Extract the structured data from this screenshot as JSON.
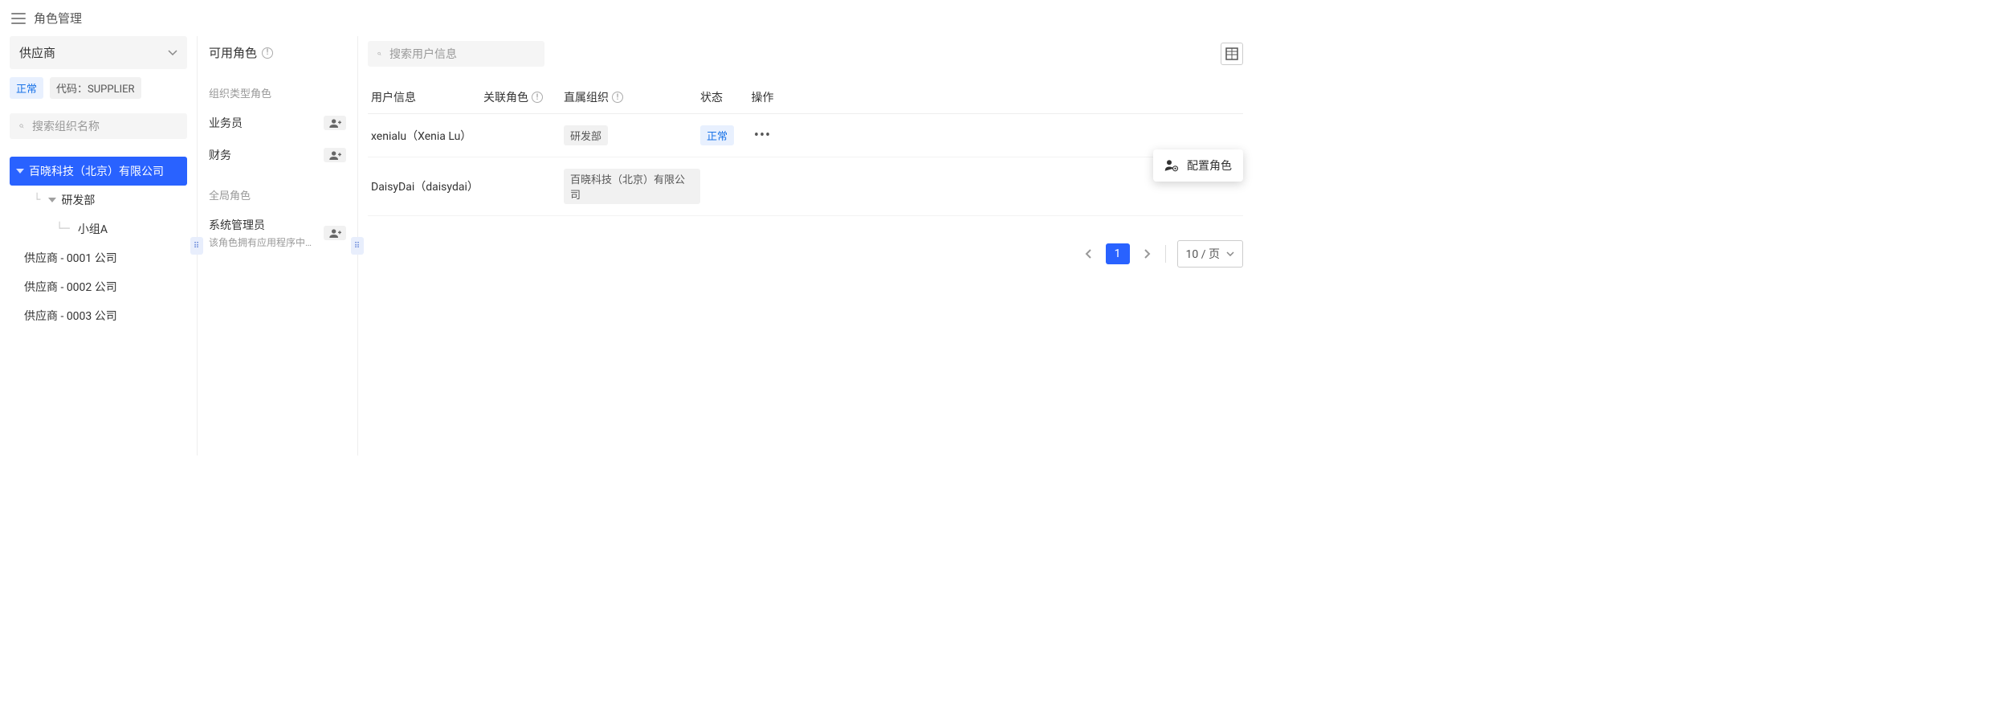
{
  "header": {
    "title": "角色管理"
  },
  "left": {
    "type_select": "供应商",
    "status_chip": "正常",
    "code_chip": "代码：SUPPLIER",
    "search_placeholder": "搜索组织名称",
    "tree": {
      "root": "百晓科技（北京）有限公司",
      "child1": "研发部",
      "grandchild1": "小组A",
      "sibling1": "供应商 - 0001 公司",
      "sibling2": "供应商 - 0002 公司",
      "sibling3": "供应商 - 0003 公司"
    }
  },
  "mid": {
    "title": "可用角色",
    "section1_title": "组织类型角色",
    "roles1": [
      {
        "label": "业务员"
      },
      {
        "label": "财务"
      }
    ],
    "section2_title": "全局角色",
    "roles2": [
      {
        "label": "系统管理员",
        "desc": "该角色拥有应用程序中…"
      }
    ]
  },
  "right": {
    "search_placeholder": "搜索用户信息",
    "columns": {
      "user": "用户信息",
      "role": "关联角色",
      "org": "直属组织",
      "status": "状态",
      "action": "操作"
    },
    "rows": [
      {
        "user": "xenialu（Xenia Lu）",
        "org": "研发部",
        "status": "正常"
      },
      {
        "user": "DaisyDai（daisydai）",
        "org": "百晓科技（北京）有限公司"
      }
    ],
    "menu_item": "配置角色",
    "pagination": {
      "current": "1",
      "page_size": "10 / 页"
    }
  }
}
